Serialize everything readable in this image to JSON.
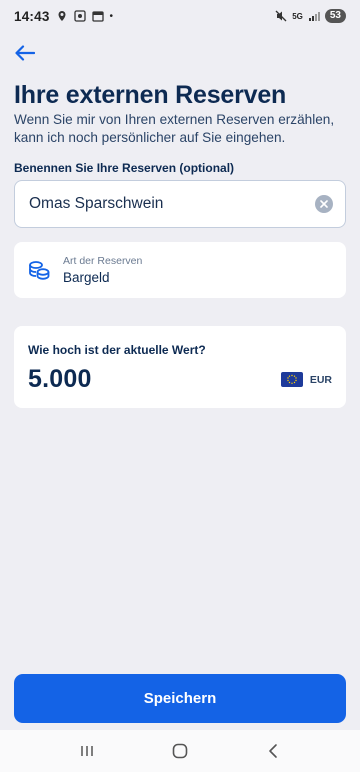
{
  "status_bar": {
    "time": "14:43",
    "battery": "53",
    "network_label": "5G"
  },
  "header": {
    "back_icon": "arrow-left-icon",
    "title": "Ihre externen Reserven",
    "subtitle": "Wenn Sie mir von Ihren externen Reserven erzählen, kann ich noch persönlicher auf Sie eingehen."
  },
  "name_field": {
    "label": "Benennen Sie Ihre Reserven (optional)",
    "value": "Omas Sparschwein",
    "clear_icon": "clear-circle-icon"
  },
  "reserve_type": {
    "icon": "coins-icon",
    "label": "Art der Reserven",
    "value": "Bargeld"
  },
  "value_card": {
    "question": "Wie hoch ist der aktuelle Wert?",
    "amount": "5.000",
    "currency_code": "EUR",
    "currency_icon": "eu-flag-icon"
  },
  "actions": {
    "save_label": "Speichern"
  },
  "colors": {
    "background": "#eeeef3",
    "primary": "#1463e6",
    "text_dark": "#0d2a52"
  }
}
